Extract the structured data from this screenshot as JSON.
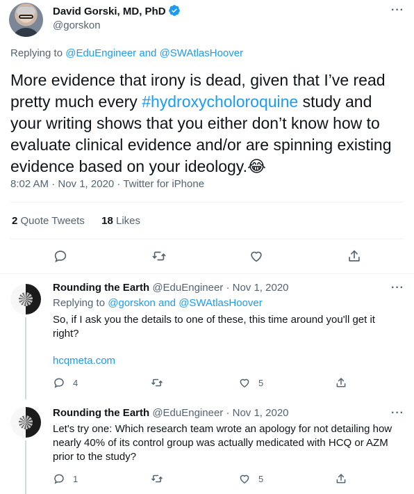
{
  "main_tweet": {
    "author_name": "David Gorski, MD, PhD",
    "author_handle": "@gorskon",
    "replying_prefix": "Replying to ",
    "replying_to_1": "@EduEngineer",
    "replying_and": " and ",
    "replying_to_2": "@SWAtlasHoover",
    "text_1": "More evidence that irony is dead, given that I’ve read pretty much every ",
    "hashtag": "#hydroxycholoroquine",
    "text_2": " study and your writing shows that you either don’t know how to evaluate clinical evidence and/or are spinning existing evidence based on your ideology.",
    "emoji": "😂",
    "timestamp": "8:02 AM · Nov 1, 2020 · Twitter for iPhone",
    "quote_count": "2",
    "quote_label": "Quote Tweets",
    "like_count": "18",
    "like_label": "Likes",
    "more_label": "···"
  },
  "replies": [
    {
      "author_name": "Rounding the Earth",
      "author_handle": "@EduEngineer",
      "date": " · Nov 1, 2020",
      "replying_prefix": "Replying to ",
      "replying_to_1": "@gorskon",
      "replying_and": " and ",
      "replying_to_2": "@SWAtlasHoover",
      "text": "So, if I ask you the details to one of these, this time around you'll get it right?",
      "link": "hcqmeta.com",
      "reply_count": "4",
      "like_count": "5",
      "more_label": "···"
    },
    {
      "author_name": "Rounding the Earth",
      "author_handle": "@EduEngineer",
      "date": " · Nov 1, 2020",
      "text": "Let's try one: Which research team wrote an apology for not detailing how nearly 40% of its control group was actually medicated with HCQ or AZM prior to the study?",
      "reply_count": "1",
      "like_count": "5",
      "more_label": "···"
    }
  ],
  "colors": {
    "accent": "#1d9bf0",
    "secondary_text": "#536471",
    "divider": "#eff3f4"
  },
  "icons": [
    "verified-badge-icon",
    "reply-icon",
    "retweet-icon",
    "like-icon",
    "share-icon",
    "more-icon"
  ]
}
